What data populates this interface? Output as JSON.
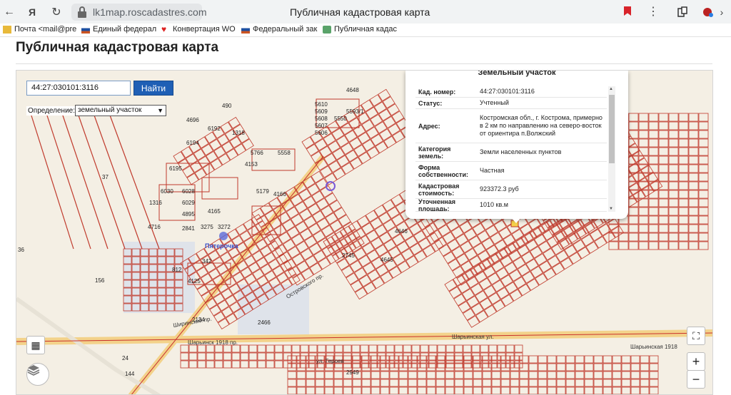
{
  "browser": {
    "url": "lk1map.roscadastres.com",
    "tab_title": "Публичная кадастровая карта",
    "bookmarks": [
      {
        "label": "Почта <mail@pre",
        "icon": "envelope-icon"
      },
      {
        "label": "Единый федерал",
        "icon": "flag-icon"
      },
      {
        "label": "Конвертация WO",
        "icon": "heart-icon"
      },
      {
        "label": "Федеральный зак",
        "icon": "flag-icon"
      },
      {
        "label": "Публичная кадас",
        "icon": "puzzle-icon"
      }
    ]
  },
  "page": {
    "title": "Публичная кадастровая карта"
  },
  "search": {
    "value": "44:27:030101:3116",
    "button": "Найти"
  },
  "definition": {
    "label": "Определение:",
    "selected": "земельный участок"
  },
  "popup": {
    "title": "Земельный участок",
    "rows": [
      {
        "key": "Кад. номер:",
        "value": "44:27:030101:3116"
      },
      {
        "key": "Статус:",
        "value": "Учтенный"
      },
      {
        "key": "Адрес:",
        "value": "Костромская обл., г. Кострома, примерно в 2 км по направлению на северо-восток от ориентира п.Волжский"
      },
      {
        "key": "Категория земель:",
        "value": "Земли населенных пунктов"
      },
      {
        "key": "Форма собственности:",
        "value": "Частная"
      },
      {
        "key": "Кадастровая стоимость:",
        "value": "923372.3 руб"
      },
      {
        "key": "Уточненная площадь:",
        "value": "1010 кв.м"
      }
    ]
  },
  "map": {
    "poi": [
      "Пятерочка"
    ],
    "parcel_labels": [
      "4648",
      "5610",
      "5609",
      "5608",
      "5607",
      "5606",
      "5550",
      "5593/1",
      "490",
      "4696",
      "6192",
      "1318",
      "6194",
      "5766",
      "5558",
      "4153",
      "6195",
      "6028",
      "6029",
      "5179",
      "4166",
      "4895",
      "4165",
      "6030",
      "1316",
      "2841",
      "3275",
      "3272",
      "4716",
      "37",
      "4646",
      "812",
      "342",
      "156",
      "4125",
      "2466",
      "2949",
      "24",
      "144",
      "36",
      "2134",
      "4645",
      "2745"
    ],
    "street_labels": [
      "Шарьинская ул.",
      "Шарьинск 1918 пр.",
      "Шарьинская 1918",
      "ул. Героев",
      "Ширинский пр.",
      "Островского пр."
    ]
  },
  "controls": {
    "zoom_in": "+",
    "zoom_out": "−"
  }
}
